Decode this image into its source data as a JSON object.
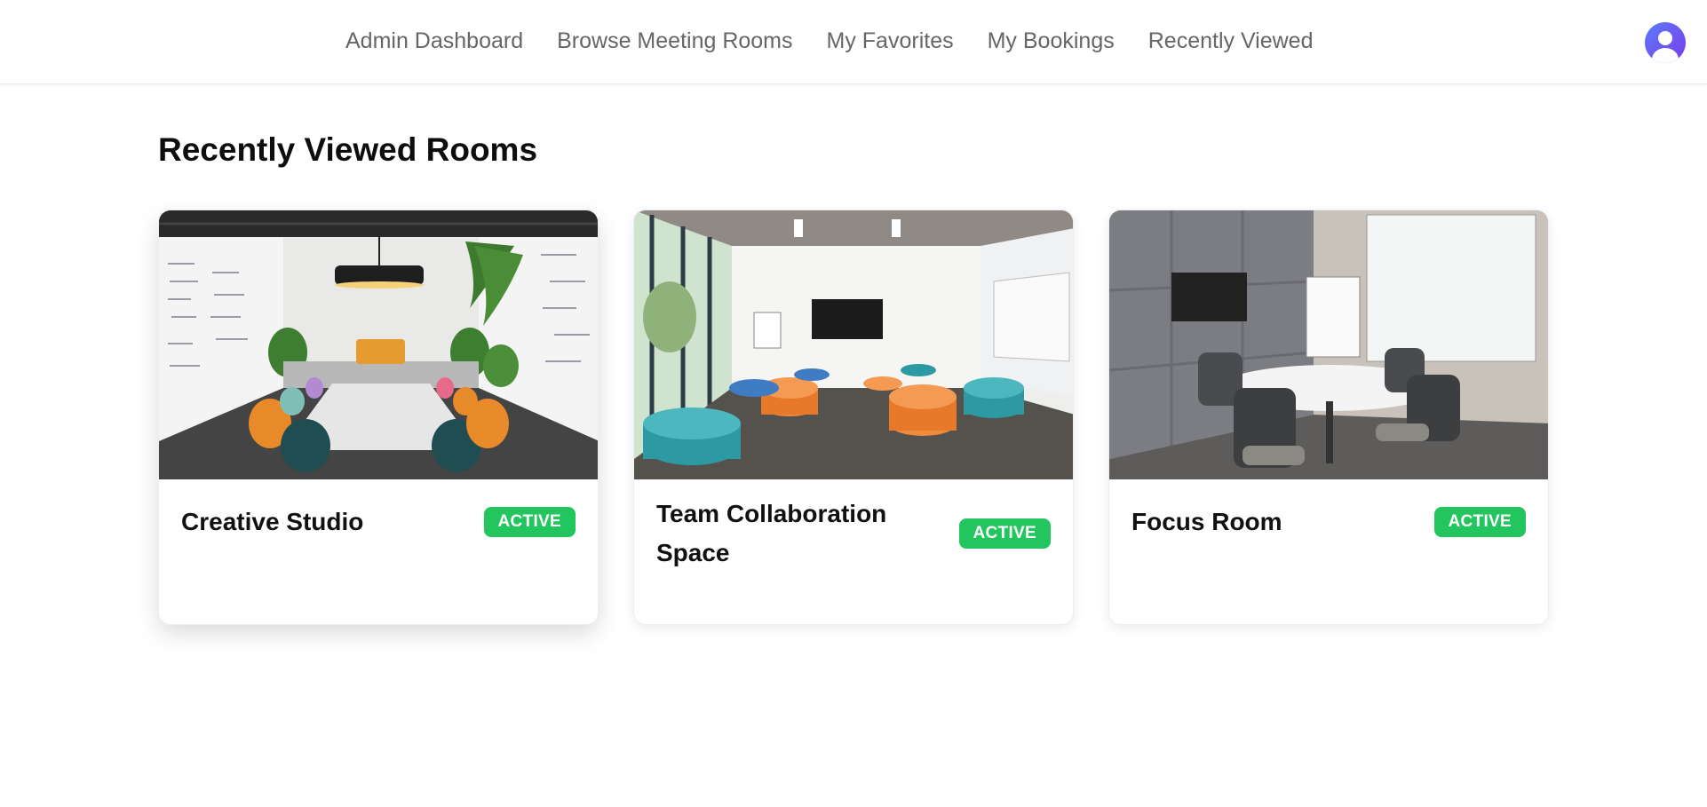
{
  "nav": {
    "items": [
      {
        "label": "Admin Dashboard"
      },
      {
        "label": "Browse Meeting Rooms"
      },
      {
        "label": "My Favorites"
      },
      {
        "label": "My Bookings"
      },
      {
        "label": "Recently Viewed"
      }
    ]
  },
  "user": {
    "avatar_icon": "user-avatar-icon"
  },
  "page": {
    "title": "Recently Viewed Rooms"
  },
  "rooms": [
    {
      "name": "Creative Studio",
      "status": "ACTIVE"
    },
    {
      "name": "Team Collaboration Space",
      "status": "ACTIVE"
    },
    {
      "name": "Focus Room",
      "status": "ACTIVE"
    }
  ],
  "colors": {
    "accent": "#22c55e",
    "avatar": "#6366f1",
    "nav_text": "#666666"
  }
}
